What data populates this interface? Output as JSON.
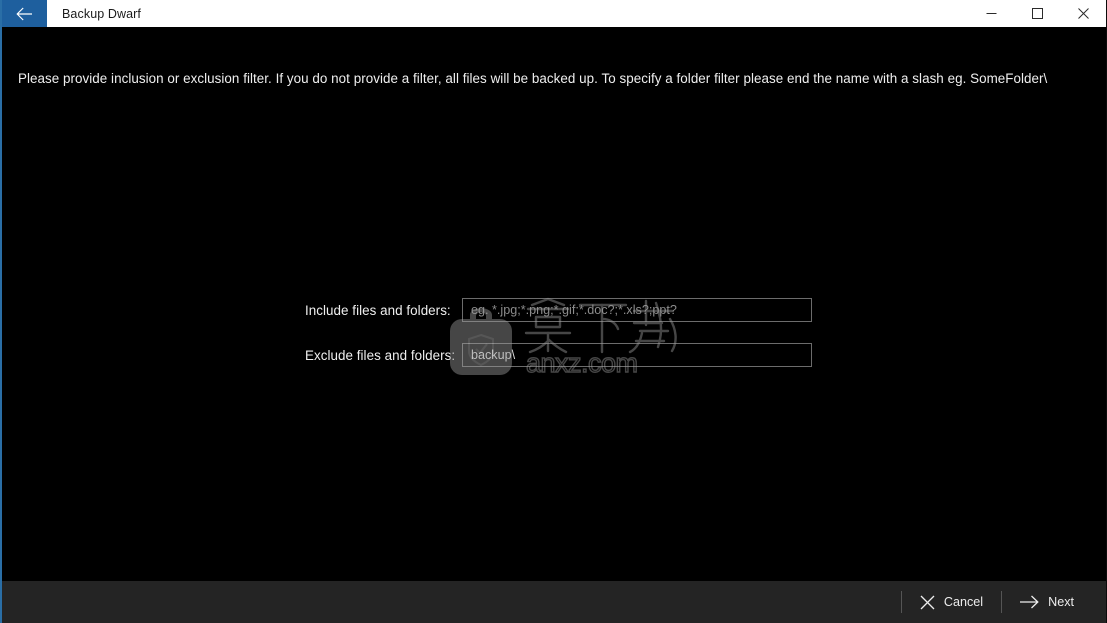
{
  "window": {
    "title": "Backup Dwarf",
    "back_icon": "back-arrow-icon",
    "minimize_icon": "minimize-icon",
    "maximize_icon": "maximize-icon",
    "close_icon": "close-icon",
    "accent_color": "#1e5f9e",
    "background_color": "#000000",
    "titlebar_color": "#ffffff"
  },
  "main": {
    "instruction": "Please provide inclusion or exclusion filter. If you do not provide a filter, all files will be backed up. To specify a folder filter please end the name with a slash eg. SomeFolder\\",
    "fields": [
      {
        "label": "Include files and folders:",
        "value": "",
        "placeholder": "eg. *.jpg;*.png;*.gif;*.doc?;*.xls?;ppt?"
      },
      {
        "label": "Exclude files and folders:",
        "value": "backup\\",
        "placeholder": ""
      }
    ]
  },
  "watermark": {
    "chinese_text": "安下载",
    "url_text": "anxz.com",
    "logo_icon": "backup-bag-shield-icon"
  },
  "footer": {
    "cancel_label": "Cancel",
    "cancel_icon": "close-x-icon",
    "next_label": "Next",
    "next_icon": "arrow-right-icon",
    "background_color": "#242424"
  }
}
